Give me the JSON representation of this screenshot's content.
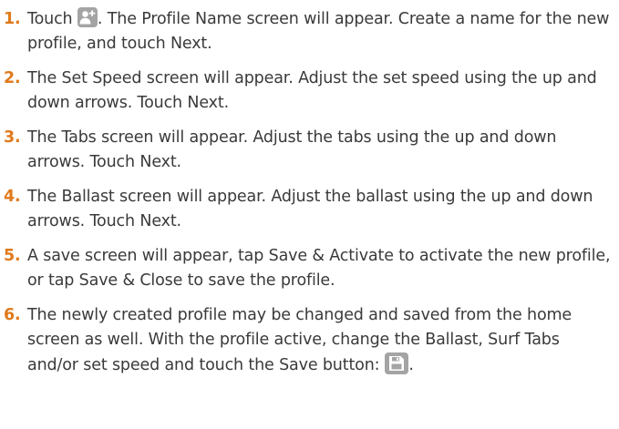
{
  "steps": [
    {
      "number": "1.",
      "before": "Touch ",
      "icon": "add-profile-icon",
      "after": ". The Profile Name screen will appear. Create a name for the new profile, and touch Next."
    },
    {
      "number": "2.",
      "text": "The Set Speed screen will appear. Adjust the set speed using the up and down arrows. Touch Next."
    },
    {
      "number": "3.",
      "text": "The Tabs screen will appear. Adjust the tabs using the up and down arrows. Touch Next."
    },
    {
      "number": "4.",
      "text": "The Ballast screen will appear. Adjust the ballast using the up and down arrows. Touch Next."
    },
    {
      "number": "5.",
      "text": "A save screen will appear, tap Save & Activate to activate the new profile, or tap Save & Close to save the profile."
    },
    {
      "number": "6.",
      "text": "The newly created profile may be changed and saved from the home screen as well. With the profile active, change the Ballast, Surf Tabs and/or set speed and touch the Save button:",
      "icon": "save-icon",
      "after": "."
    }
  ],
  "colors": {
    "step_number": "#e07a1c",
    "body_text": "#3a3a3a",
    "icon_tile": "#a4a4a4",
    "icon_glyph": "#ffffff"
  }
}
